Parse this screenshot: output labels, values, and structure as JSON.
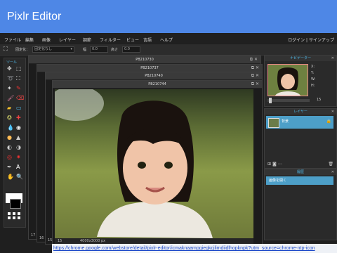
{
  "app": {
    "title": "Pixlr Editor"
  },
  "menu": {
    "items": [
      "ファイル",
      "編集",
      "画像",
      "レイヤー",
      "調節",
      "フィルター",
      "ビュー",
      "言語",
      "ヘルプ"
    ],
    "login": "ログイン",
    "signup": "サインアップ"
  },
  "options": {
    "fixed_label": "固定化：",
    "fixed_value": "固定化なし",
    "w_label": "幅",
    "w_value": "0.0",
    "h_label": "高さ",
    "h_value": "0.0"
  },
  "toolbox": {
    "title": "ツール"
  },
  "documents": [
    {
      "title": "PB210730",
      "number": "17"
    },
    {
      "title": "PB210737",
      "number": "16"
    },
    {
      "title": "PB210740",
      "number": "15"
    },
    {
      "title": "PB210744",
      "number": "15"
    }
  ],
  "status": {
    "zoom": "15",
    "size": "4000x3000 px"
  },
  "navigator": {
    "title": "ナビゲーター",
    "x_label": "X:",
    "y_label": "Y:",
    "w_label": "W:",
    "h_label": "H:",
    "zoom": "15"
  },
  "layers": {
    "title": "レイヤー",
    "layer_name": "背景"
  },
  "history": {
    "title": "履歴",
    "item": "画像を開く"
  },
  "url": "https://chrome.google.com/webstore/detail/pixlr-editor/icmaknaampgiegkcjlimdiidlhopknpk?utm_source=chrome-ntp-icon",
  "colors": {
    "accent": "#4e87e6",
    "panel_title": "#4fb7e6",
    "selection": "#4d9fc8"
  }
}
